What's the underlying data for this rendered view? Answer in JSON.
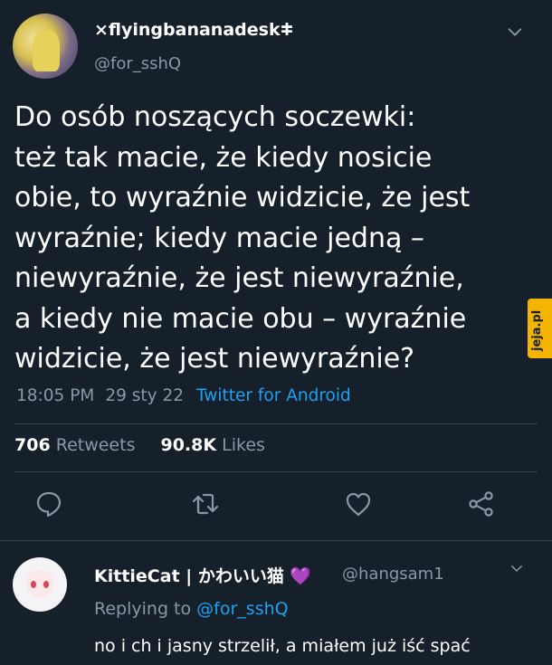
{
  "tweet": {
    "display_name": "×flyingbananadeskⵐ",
    "handle": "@for_sshQ",
    "text": "Do osób noszących soczewki:\nteż tak macie, że kiedy nosicie\nobie, to wyraźnie widzicie, że jest\nwyraźnie; kiedy macie jedną –\nniewyraźnie, że jest niewyraźnie,\na kiedy nie macie obu – wyraźnie\nwidzicie, że jest niewyraźnie?",
    "time": "18:05 PM",
    "date": "29 sty 22",
    "source": "Twitter for Android",
    "retweets_count": "706",
    "retweets_label": "Retweets",
    "likes_count": "90.8K",
    "likes_label": "Likes"
  },
  "actions": {
    "reply_icon": "comment-icon",
    "retweet_icon": "retweet-icon",
    "like_icon": "heart-icon",
    "share_icon": "share-icon"
  },
  "reply": {
    "display_name": "KittieCat | かわいい猫 💜",
    "handle": "@hangsam1",
    "replying_prefix": "Replying to",
    "replying_to": "@for_sshQ",
    "text": "no i ch  i jasny strzelił, a miałem już iść spać"
  },
  "watermark": {
    "text": "jeja.pl",
    "color": "#f5b400"
  },
  "colors": {
    "background": "#15202b",
    "secondary_text": "#8899a6",
    "accent": "#1da1f2",
    "divider": "#38444d"
  }
}
